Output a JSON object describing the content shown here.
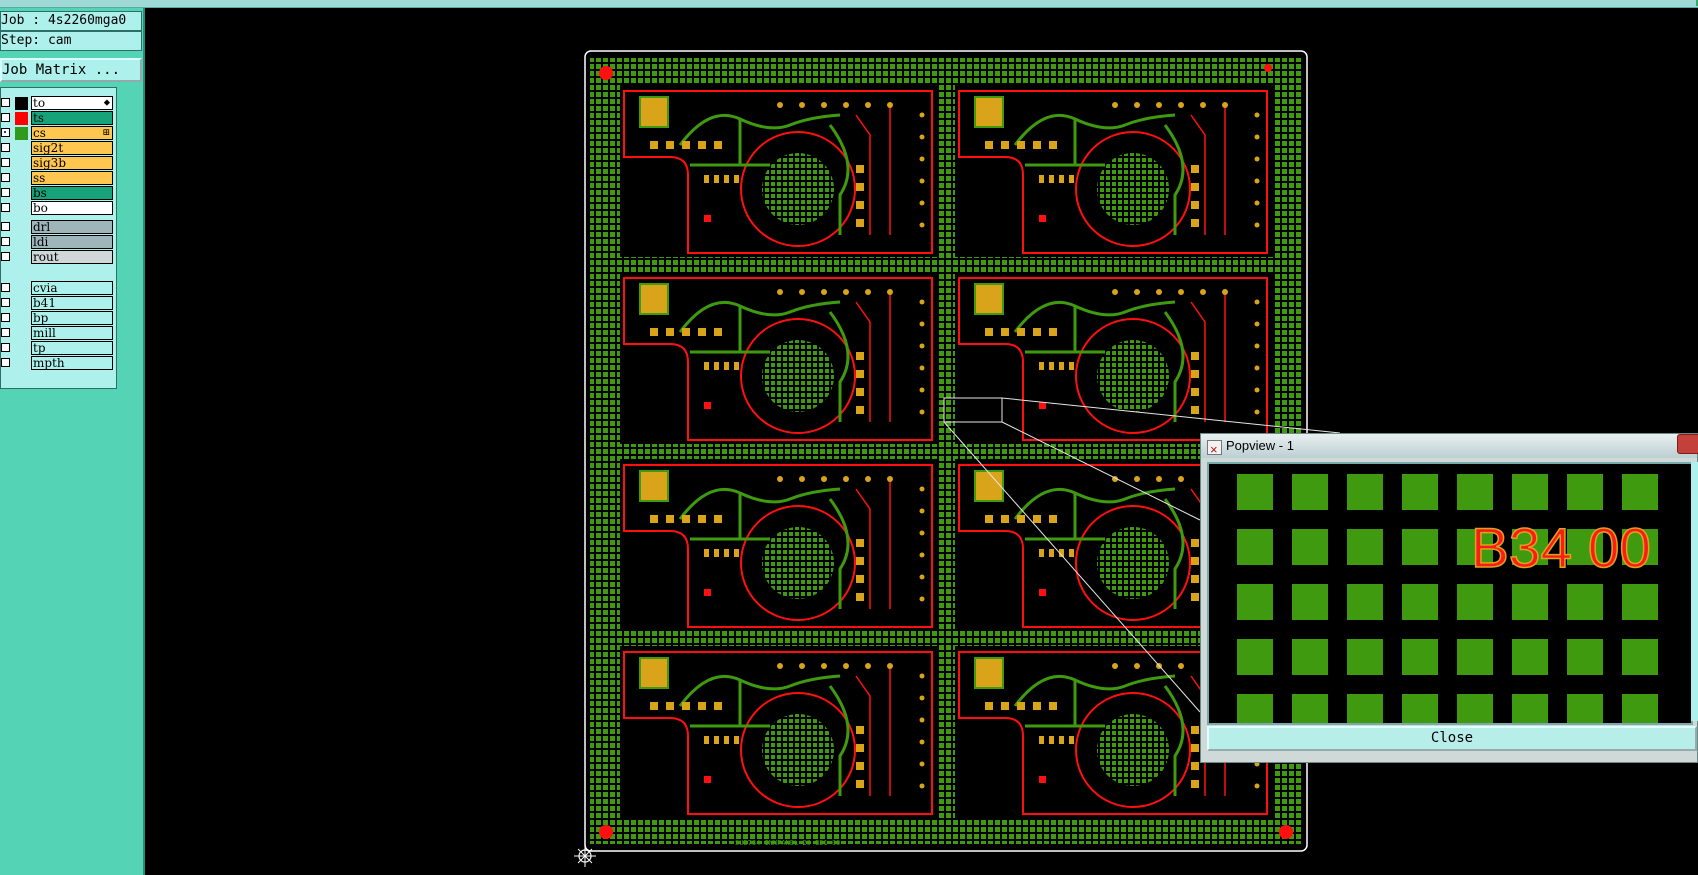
{
  "job": {
    "text": "Job : 4s2260mga0"
  },
  "step": {
    "text": "Step: cam"
  },
  "job_matrix_label": "Job Matrix ...",
  "layers_board": [
    {
      "name": "to",
      "color": "#ffffff",
      "swatch": "#000000",
      "mark": "⬥",
      "checked": false
    },
    {
      "name": "ts",
      "color": "#17a37a",
      "swatch": "#ff0000",
      "mark": "",
      "checked": false
    },
    {
      "name": "cs",
      "color": "#ffc74f",
      "swatch": "#2f9a1c",
      "mark": "⊞",
      "checked": true
    },
    {
      "name": "sig2t",
      "color": "#ffc74f",
      "swatch": "",
      "mark": "",
      "checked": false
    },
    {
      "name": "sig3b",
      "color": "#ffc74f",
      "swatch": "",
      "mark": "",
      "checked": false
    },
    {
      "name": "ss",
      "color": "#ffc74f",
      "swatch": "",
      "mark": "",
      "checked": false
    },
    {
      "name": "bs",
      "color": "#17a37a",
      "swatch": "",
      "mark": "",
      "checked": false
    },
    {
      "name": "bo",
      "color": "#ffffff",
      "swatch": "",
      "mark": "",
      "checked": false
    }
  ],
  "layers_drill": [
    {
      "name": "drl",
      "color": "#9fb5ba"
    },
    {
      "name": "ldi",
      "color": "#9fb5ba"
    },
    {
      "name": "rout",
      "color": "#cfd7d8"
    }
  ],
  "layers_misc": [
    {
      "name": "cvia",
      "color": "#aef0ec"
    },
    {
      "name": "b41",
      "color": "#aef0ec"
    },
    {
      "name": "bp",
      "color": "#aef0ec"
    },
    {
      "name": "mill",
      "color": "#aef0ec"
    },
    {
      "name": "tp",
      "color": "#aef0ec"
    },
    {
      "name": "mpth",
      "color": "#aef0ec"
    }
  ],
  "board_label": "SUB784 INNPANEL-20   B31 00",
  "popview": {
    "title": "Popview - 1",
    "zoom_text": "B34 00",
    "close_label": "Close"
  },
  "colors": {
    "pad_green": "#3f9a0f",
    "trace_red": "#ff1010",
    "copper_orange": "#d9a31a",
    "panel_teal": "#54d3b5"
  }
}
